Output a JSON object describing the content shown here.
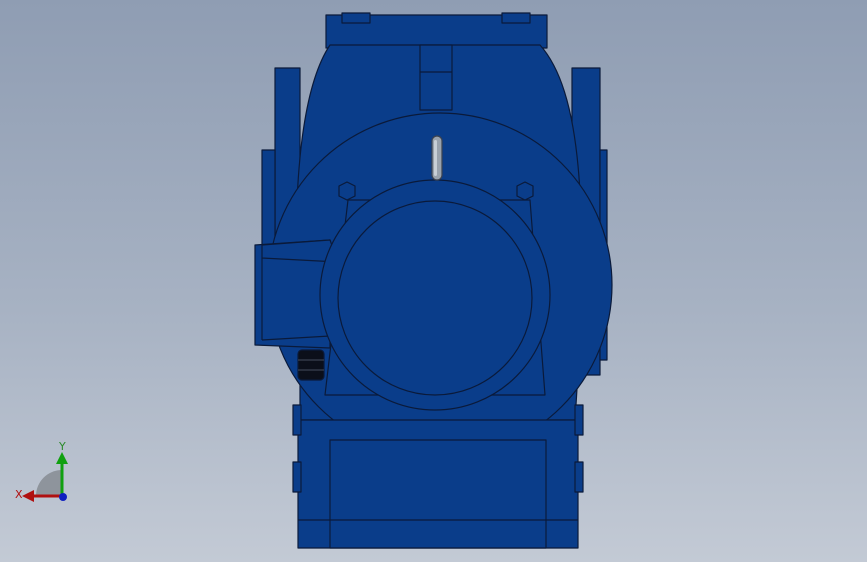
{
  "viewport": {
    "background_top": "#8f9db3",
    "background_bottom": "#c3cad5",
    "model_color": "#0a3d8a",
    "model_edge_color": "#0a1a3a"
  },
  "triad": {
    "x_label": "X",
    "y_label": "Y",
    "x_color": "#b01010",
    "y_color": "#10a010",
    "origin_color": "#1020c0"
  }
}
